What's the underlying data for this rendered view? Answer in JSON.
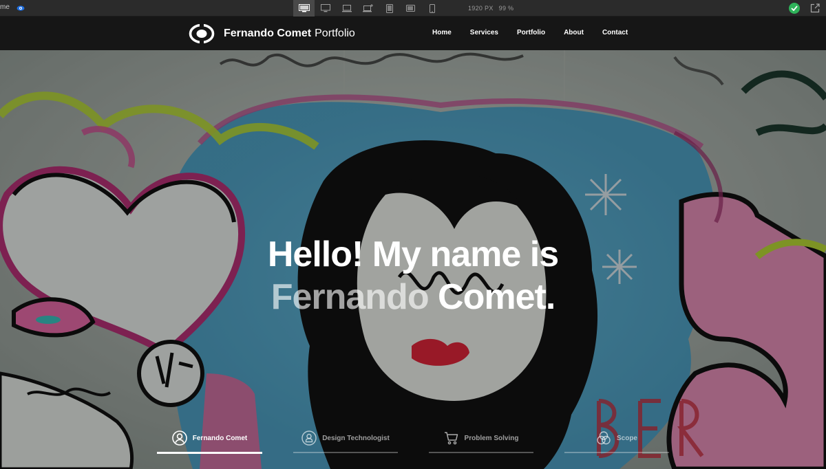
{
  "editor": {
    "app_label": "me",
    "size_value": "1920 PX",
    "zoom_value": "99 %",
    "devices": [
      "desktop-large-icon",
      "desktop-icon",
      "laptop-icon",
      "laptop-plus-icon",
      "tablet-icon",
      "tablet-landscape-icon",
      "phone-icon"
    ],
    "accent": "#2fb35a"
  },
  "site": {
    "brand": {
      "name": "Fernando Comet",
      "suffix": "Portfolio"
    },
    "nav": [
      "Home",
      "Services",
      "Portfolio",
      "About",
      "Contact"
    ]
  },
  "hero": {
    "line1": "Hello! My name is",
    "name_first": "Fernando",
    "name_last": "Comet."
  },
  "tabs": [
    {
      "label": "Fernando Comet",
      "icon": "user-icon",
      "active": true
    },
    {
      "label": "Design Technologist",
      "icon": "badge-user-icon",
      "active": false
    },
    {
      "label": "Problem Solving",
      "icon": "shopping-cart-icon",
      "active": false
    },
    {
      "label": "Scope",
      "icon": "venn-circles-icon",
      "active": false
    }
  ]
}
